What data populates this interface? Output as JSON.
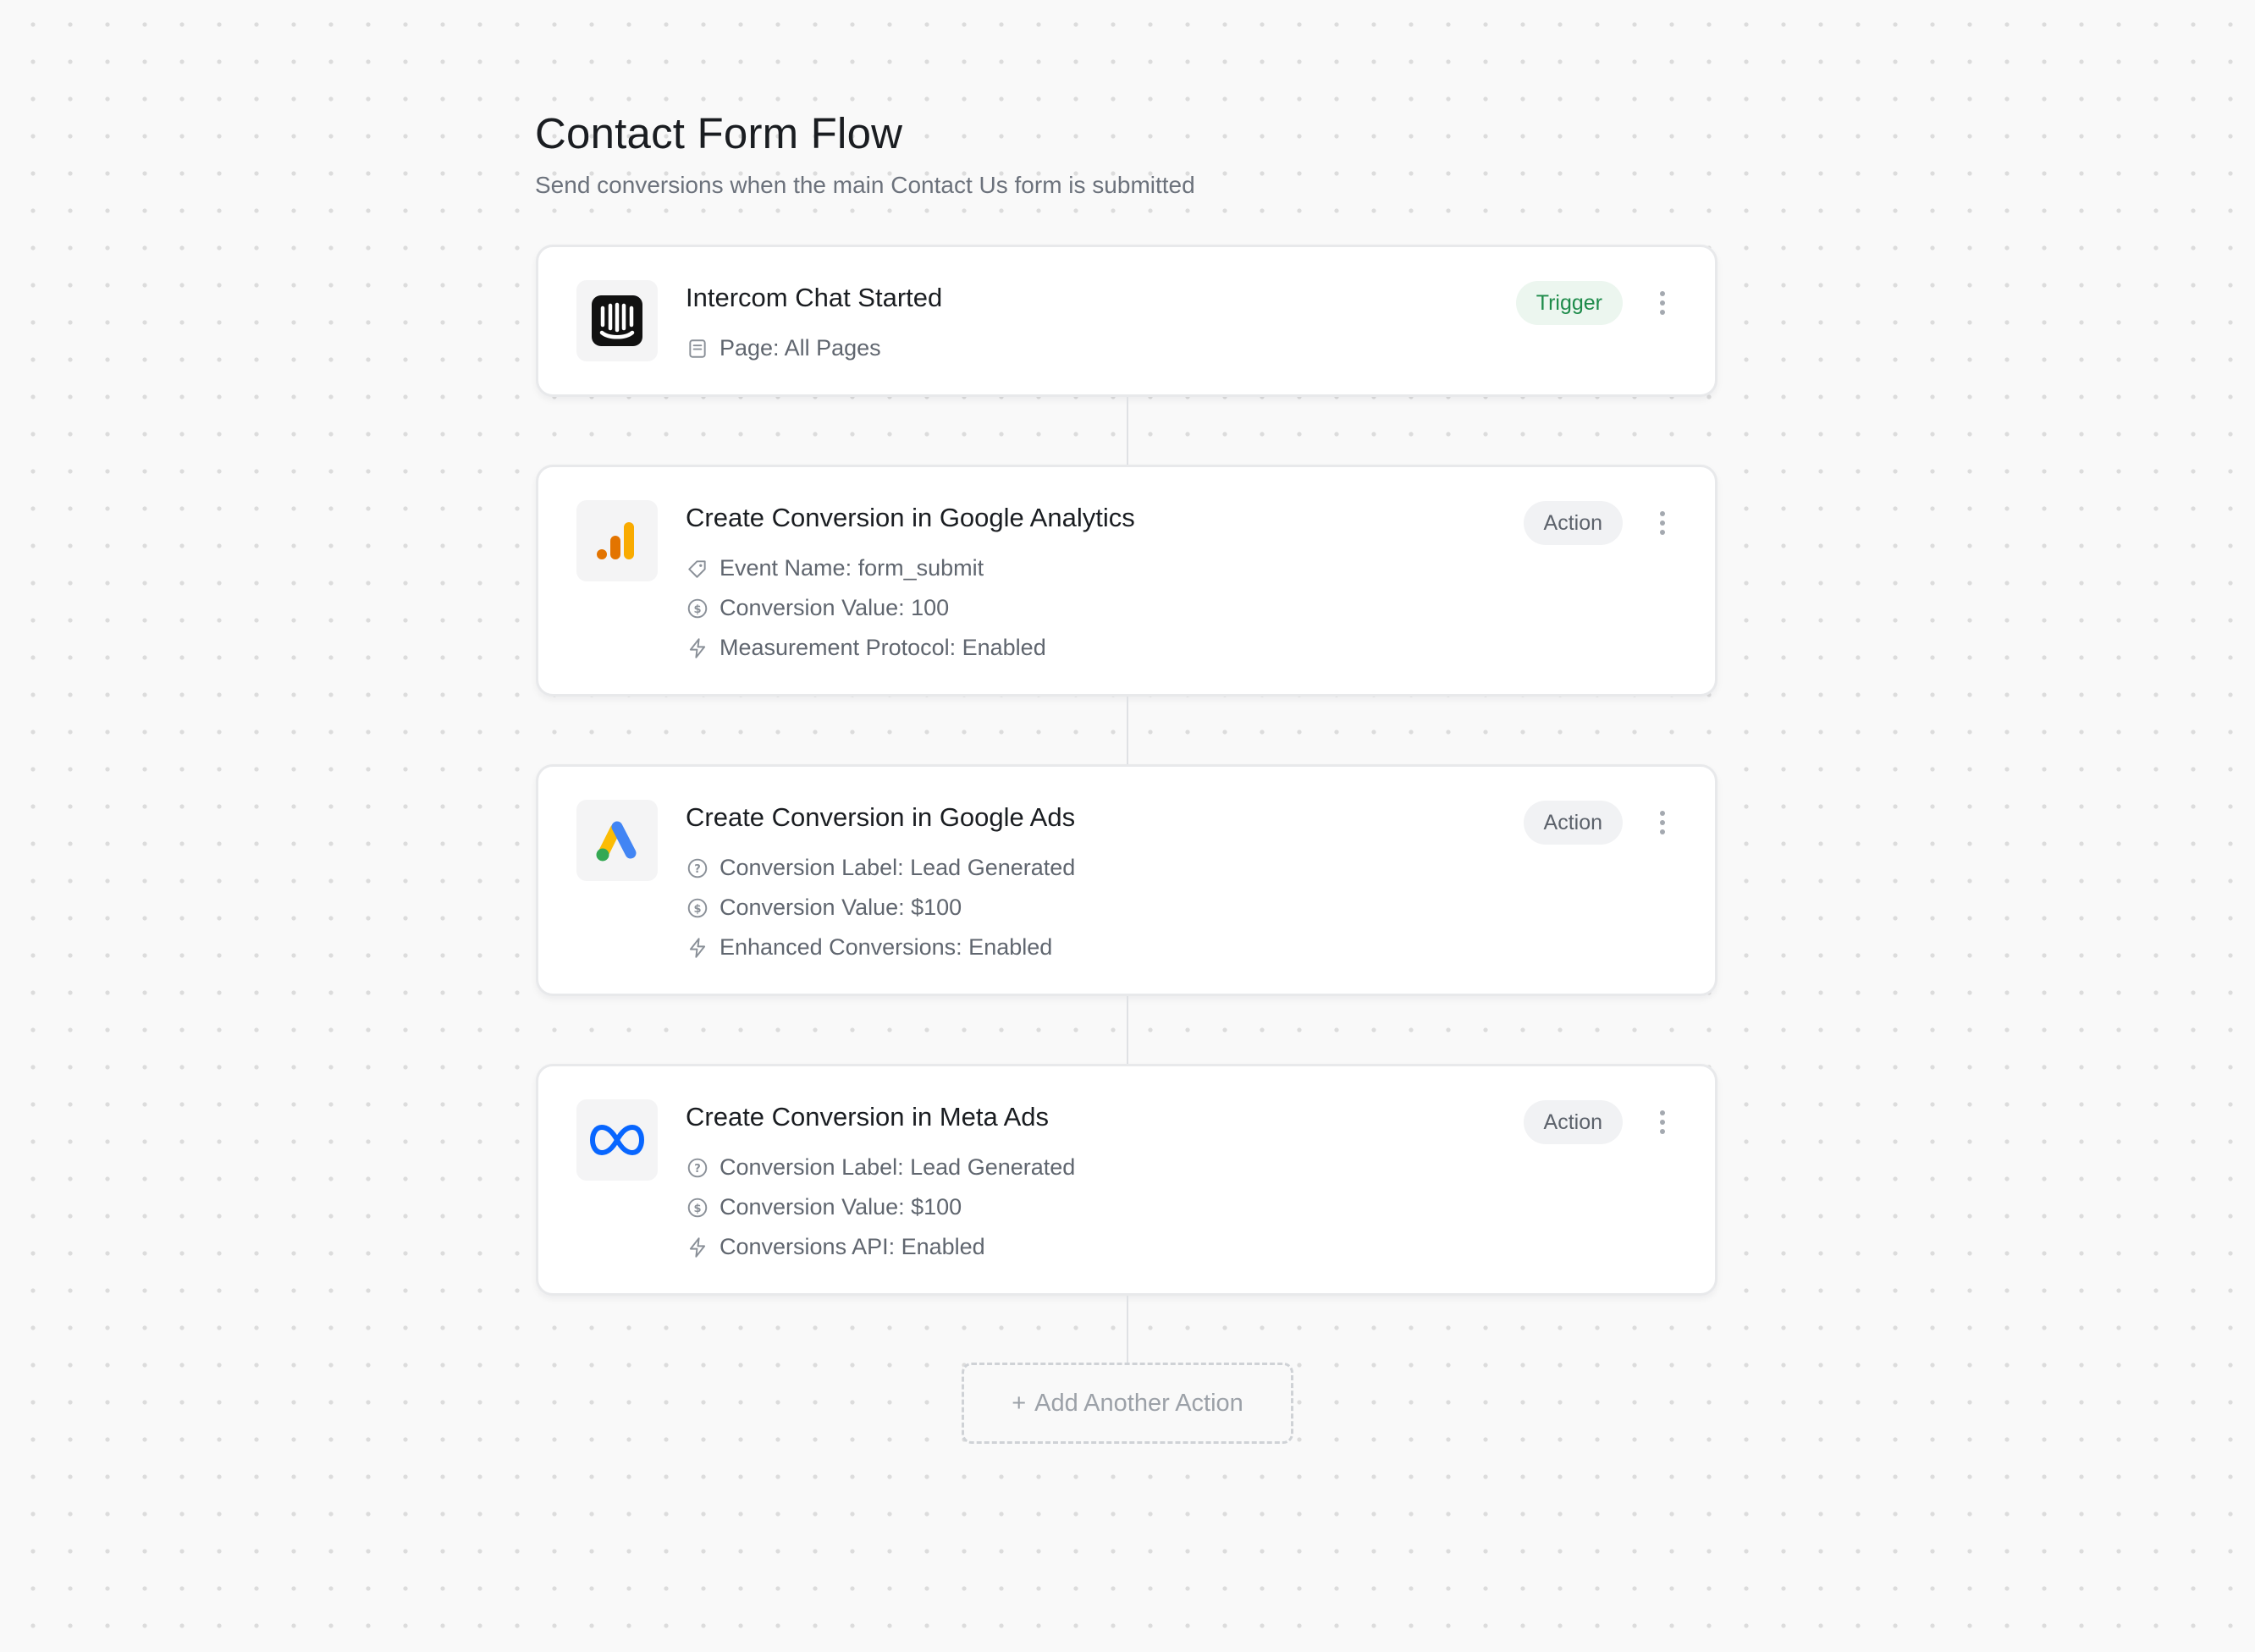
{
  "page": {
    "title": "Contact Form Flow",
    "subtitle": "Send conversions when the main Contact Us form is submitted"
  },
  "trigger": {
    "title": "Intercom Chat Started",
    "badge": "Trigger",
    "logo": "intercom-logo",
    "details": [
      {
        "icon": "page-icon",
        "text": "Page: All Pages"
      }
    ]
  },
  "actions": [
    {
      "title": "Create Conversion in Google Analytics",
      "badge": "Action",
      "logo": "google-analytics-logo",
      "details": [
        {
          "icon": "tag-icon",
          "text": "Event Name: form_submit"
        },
        {
          "icon": "dollar-circle-icon",
          "text": "Conversion Value: 100"
        },
        {
          "icon": "lightning-icon",
          "text": "Measurement Protocol: Enabled"
        }
      ]
    },
    {
      "title": "Create Conversion in Google Ads",
      "badge": "Action",
      "logo": "google-ads-logo",
      "details": [
        {
          "icon": "question-circle-icon",
          "text": "Conversion Label: Lead Generated"
        },
        {
          "icon": "dollar-circle-icon",
          "text": "Conversion Value: $100"
        },
        {
          "icon": "lightning-icon",
          "text": "Enhanced Conversions: Enabled"
        }
      ]
    },
    {
      "title": "Create Conversion in Meta Ads",
      "badge": "Action",
      "logo": "meta-logo",
      "details": [
        {
          "icon": "question-circle-icon",
          "text": "Conversion Label: Lead Generated"
        },
        {
          "icon": "dollar-circle-icon",
          "text": "Conversion Value: $100"
        },
        {
          "icon": "lightning-icon",
          "text": "Conversions API: Enabled"
        }
      ]
    }
  ],
  "add_action": {
    "plus": "+",
    "label": "Add Another Action"
  },
  "colors": {
    "trigger_badge_bg": "#ecf6ef",
    "trigger_badge_text": "#1e8b4a",
    "action_badge_bg": "#f1f2f4",
    "ga_orange": "#f9ab00",
    "ga_dark_orange": "#e37400",
    "ads_blue": "#4285f4",
    "ads_yellow": "#fbbc04",
    "ads_green": "#34a853",
    "meta_blue": "#0866ff"
  }
}
